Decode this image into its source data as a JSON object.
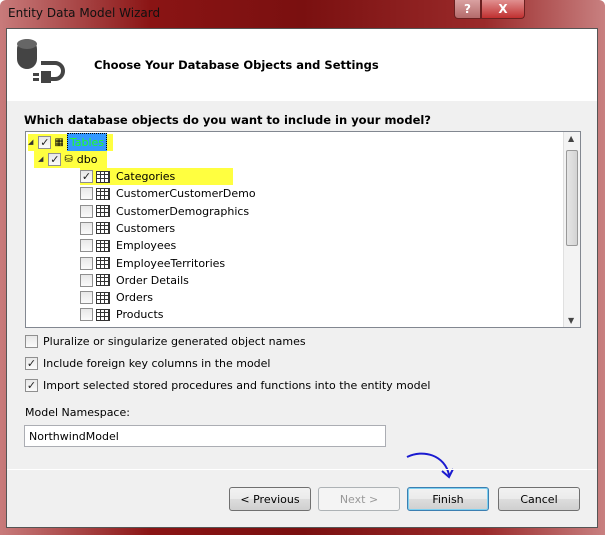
{
  "window": {
    "title": "Entity Data Model Wizard",
    "help_label": "?",
    "close_label": "X"
  },
  "header": {
    "title": "Choose Your Database Objects and Settings"
  },
  "question": "Which database objects do you want to include in your model?",
  "tree": {
    "root": {
      "label": "Tables",
      "checked": true
    },
    "schema": {
      "label": "dbo",
      "checked": true
    },
    "tables": [
      {
        "label": "Categories",
        "checked": true
      },
      {
        "label": "CustomerCustomerDemo",
        "checked": false
      },
      {
        "label": "CustomerDemographics",
        "checked": false
      },
      {
        "label": "Customers",
        "checked": false
      },
      {
        "label": "Employees",
        "checked": false
      },
      {
        "label": "EmployeeTerritories",
        "checked": false
      },
      {
        "label": "Order Details",
        "checked": false
      },
      {
        "label": "Orders",
        "checked": false
      },
      {
        "label": "Products",
        "checked": false
      }
    ]
  },
  "options": [
    {
      "label": "Pluralize or singularize generated object names",
      "checked": false
    },
    {
      "label": "Include foreign key columns in the model",
      "checked": true
    },
    {
      "label": "Import selected stored procedures and functions into the entity model",
      "checked": true
    }
  ],
  "namespace": {
    "label": "Model Namespace:",
    "value": "NorthwindModel"
  },
  "buttons": {
    "previous": "< Previous",
    "next": "Next >",
    "finish": "Finish",
    "cancel": "Cancel"
  },
  "colors": {
    "highlight": "#ffff40",
    "annotation": "#1a1ad0"
  }
}
